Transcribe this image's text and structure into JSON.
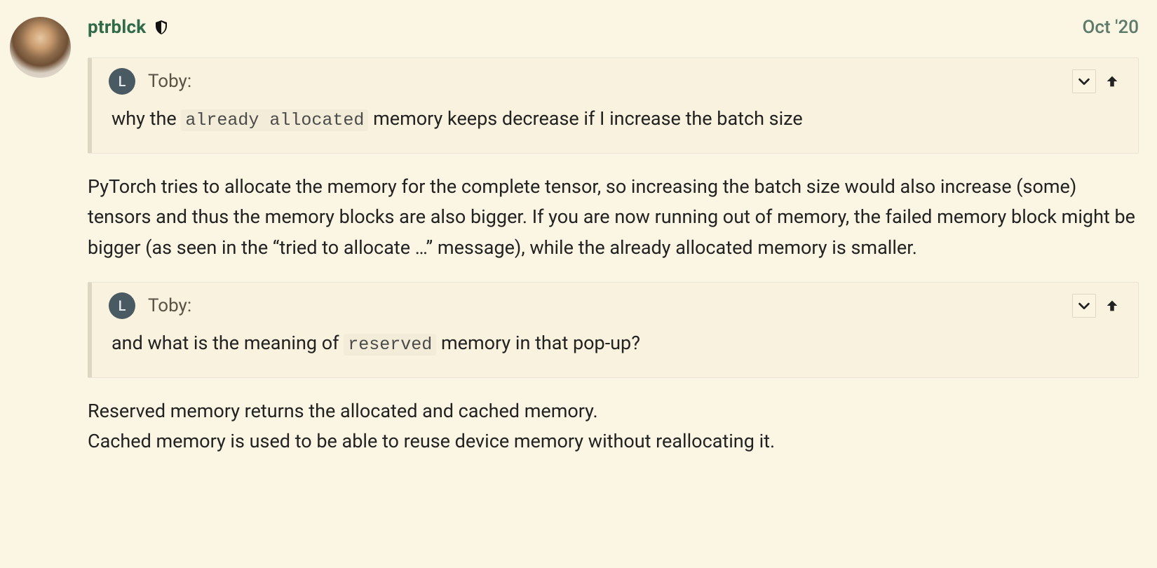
{
  "post": {
    "author": "ptrblck",
    "date": "Oct '20",
    "quote1": {
      "avatar_letter": "L",
      "name": "Toby:",
      "text_before_code": "why the ",
      "code": "already allocated",
      "text_after_code": " memory keeps decrease if I increase the batch size"
    },
    "paragraph1": "PyTorch tries to allocate the memory for the complete tensor, so increasing the batch size would also increase (some) tensors and thus the memory blocks are also bigger. If you are now running out of memory, the failed memory block might be bigger (as seen in the “tried to allocate …” message), while the already allocated memory is smaller.",
    "quote2": {
      "avatar_letter": "L",
      "name": "Toby:",
      "text_before_code": "and what is the meaning of ",
      "code": "reserved",
      "text_after_code": " memory in that pop-up?"
    },
    "paragraph2_line1": "Reserved memory returns the allocated and cached memory.",
    "paragraph2_line2": "Cached memory is used to be able to reuse device memory without reallocating it."
  }
}
